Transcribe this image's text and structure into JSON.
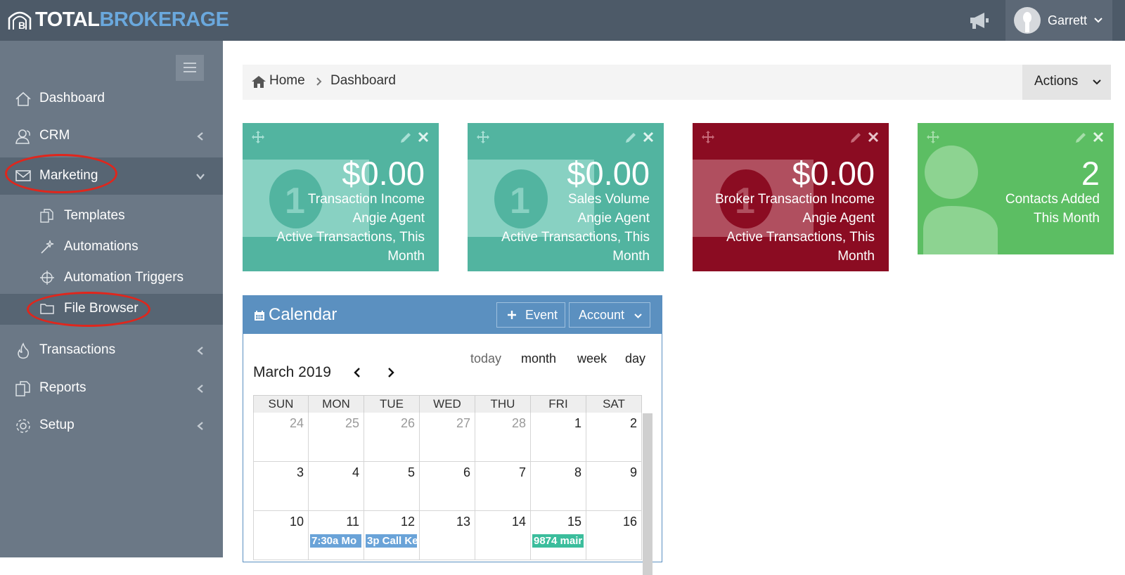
{
  "brand": {
    "part1": "TOTAL",
    "part2": "BROKERAGE"
  },
  "header": {
    "user_name": "Garrett"
  },
  "sidebar": {
    "items": [
      {
        "label": "Dashboard",
        "icon": "home-outline-icon"
      },
      {
        "label": "CRM",
        "icon": "users-icon"
      },
      {
        "label": "Marketing",
        "icon": "envelope-icon"
      },
      {
        "label": "Transactions",
        "icon": "fire-icon"
      },
      {
        "label": "Reports",
        "icon": "files-icon"
      },
      {
        "label": "Setup",
        "icon": "gear-icon"
      }
    ],
    "marketing_sub": [
      {
        "label": "Templates",
        "icon": "copy-icon"
      },
      {
        "label": "Automations",
        "icon": "magic-wand-icon"
      },
      {
        "label": "Automation Triggers",
        "icon": "crosshair-icon"
      },
      {
        "label": "File Browser",
        "icon": "folder-icon"
      }
    ]
  },
  "breadcrumb": {
    "home": "Home",
    "current": "Dashboard",
    "actions": "Actions"
  },
  "tiles": [
    {
      "amount": "$0.00",
      "lines": [
        "Transaction Income",
        "Angie Agent",
        "Active Transactions, This",
        "Month"
      ],
      "color": "#52b4a0"
    },
    {
      "amount": "$0.00",
      "lines": [
        "Sales Volume",
        "Angie Agent",
        "Active Transactions, This",
        "Month"
      ],
      "color": "#52b4a0"
    },
    {
      "amount": "$0.00",
      "lines": [
        "Broker Transaction Income",
        "Angie Agent",
        "Active Transactions, This",
        "Month"
      ],
      "color": "#8b0c22"
    },
    {
      "amount": "2",
      "lines": [
        "Contacts Added",
        "This Month"
      ],
      "color": "#5cbe63"
    }
  ],
  "calendar": {
    "title": "Calendar",
    "event_btn": "Event",
    "account_btn": "Account",
    "month_label": "March 2019",
    "views": [
      "today",
      "month",
      "week",
      "day"
    ],
    "weekdays": [
      "SUN",
      "MON",
      "TUE",
      "WED",
      "THU",
      "FRI",
      "SAT"
    ],
    "weeks": [
      [
        {
          "d": "24",
          "o": true
        },
        {
          "d": "25",
          "o": true
        },
        {
          "d": "26",
          "o": true
        },
        {
          "d": "27",
          "o": true
        },
        {
          "d": "28",
          "o": true
        },
        {
          "d": "1",
          "o": false
        },
        {
          "d": "2",
          "o": false
        }
      ],
      [
        {
          "d": "3",
          "o": false
        },
        {
          "d": "4",
          "o": false
        },
        {
          "d": "5",
          "o": false
        },
        {
          "d": "6",
          "o": false
        },
        {
          "d": "7",
          "o": false
        },
        {
          "d": "8",
          "o": false
        },
        {
          "d": "9",
          "o": false
        }
      ],
      [
        {
          "d": "10",
          "o": false
        },
        {
          "d": "11",
          "o": false
        },
        {
          "d": "12",
          "o": false
        },
        {
          "d": "13",
          "o": false
        },
        {
          "d": "14",
          "o": false
        },
        {
          "d": "15",
          "o": false
        },
        {
          "d": "16",
          "o": false
        }
      ]
    ],
    "events": [
      {
        "day_index": 1,
        "week": 2,
        "text": "7:30a Mo",
        "color": "#6aa3d8"
      },
      {
        "day_index": 2,
        "week": 2,
        "text": "3p Call Ke",
        "color": "#6aa3d8"
      },
      {
        "day_index": 5,
        "week": 2,
        "text": "9874 mair",
        "color": "#3bbd9c"
      }
    ]
  }
}
